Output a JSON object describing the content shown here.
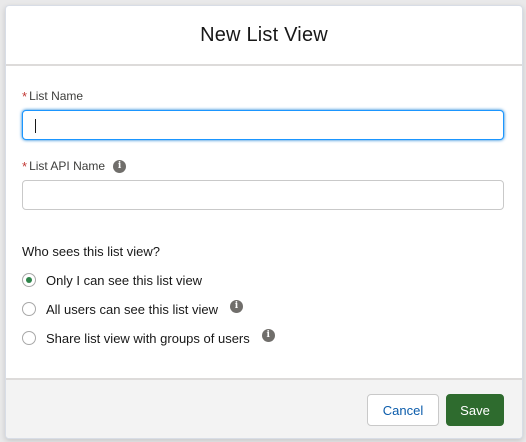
{
  "modal": {
    "title": "New List View"
  },
  "form": {
    "list_name": {
      "required_mark": "*",
      "label": "List Name",
      "value": ""
    },
    "list_api_name": {
      "required_mark": "*",
      "label": "List API Name",
      "value": "",
      "info_icon": "i"
    }
  },
  "visibility": {
    "question": "Who sees this list view?",
    "options": [
      {
        "label": "Only I can see this list view",
        "selected": true
      },
      {
        "label": "All users can see this list view",
        "selected": false,
        "info_icon": "i"
      },
      {
        "label": "Share list view with groups of users",
        "selected": false,
        "info_icon": "i"
      }
    ]
  },
  "footer": {
    "cancel_label": "Cancel",
    "save_label": "Save"
  },
  "colors": {
    "save_button": "#2e6b2e",
    "radio_selected": "#2e844a",
    "focus_border": "#1b96ff",
    "required": "#c23934"
  }
}
